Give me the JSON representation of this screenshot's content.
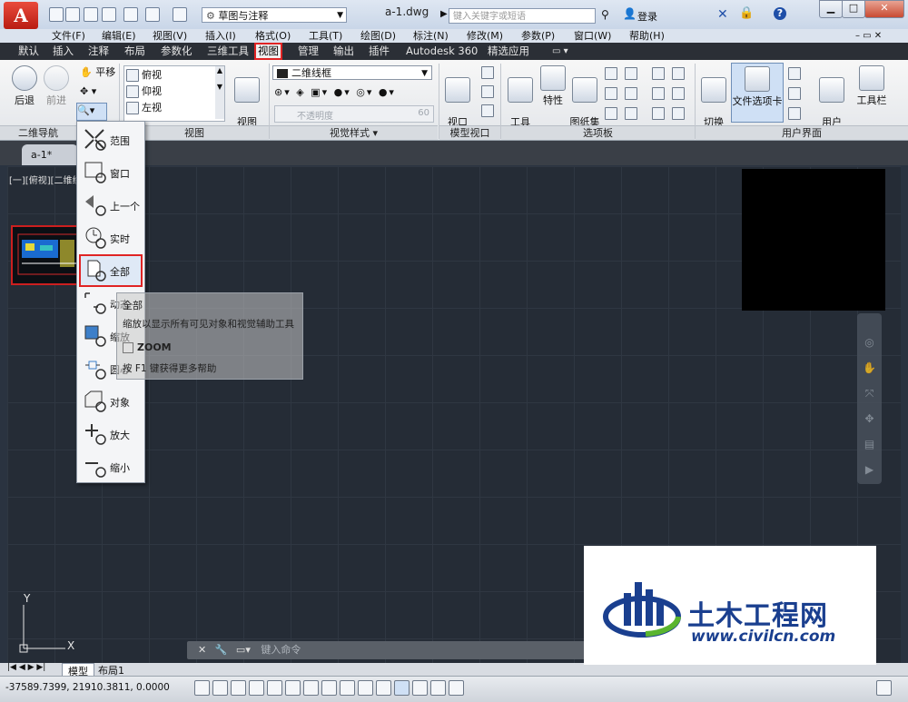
{
  "titlebar": {
    "app_letter": "A",
    "workspace": "草图与注释",
    "doc_title": "a-1.dwg",
    "search_placeholder": "键入关键字或短语",
    "login": "登录",
    "help": "?"
  },
  "menu": [
    "文件(F)",
    "编辑(E)",
    "视图(V)",
    "插入(I)",
    "格式(O)",
    "工具(T)",
    "绘图(D)",
    "标注(N)",
    "修改(M)",
    "参数(P)",
    "窗口(W)",
    "帮助(H)"
  ],
  "ribbon_tabs": [
    "默认",
    "插入",
    "注释",
    "布局",
    "参数化",
    "三维工具",
    "视图",
    "管理",
    "输出",
    "插件",
    "Autodesk 360",
    "精选应用"
  ],
  "active_tab": "视图",
  "ribbon": {
    "nav2d": {
      "back": "后退",
      "forward": "前进",
      "pan": "平移",
      "title": "二维导航"
    },
    "views": {
      "items": [
        "俯视",
        "仰视",
        "左视"
      ],
      "manager": "视图\n管理器",
      "title": "视图"
    },
    "visual": {
      "style": "二维线框",
      "opacity_label": "不透明度",
      "opacity_value": "60",
      "title": "视觉样式"
    },
    "model_viewports": {
      "config": "视口\n配置",
      "title": "模型视口"
    },
    "palettes": {
      "tool_palette": "工具\n选项板",
      "properties": "特性",
      "sheet_set": "图纸集\n管理器",
      "title": "选项板"
    },
    "ui": {
      "switch_window": "切换\n窗口",
      "file_tabs": "文件选项卡",
      "user_interface": "用户\n界面",
      "toolbars": "工具栏",
      "title": "用户界面"
    }
  },
  "doc_tab": "a-1*",
  "viewport_label": "[一][俯视][二维线",
  "zoom_menu": [
    "范围",
    "窗口",
    "上一个",
    "实时",
    "全部",
    "动态",
    "缩放",
    "圆心",
    "对象",
    "放大",
    "缩小"
  ],
  "zoom_selected": "全部",
  "tooltip": {
    "title": "全部",
    "desc": "缩放以显示所有可见对象和视觉辅助工具",
    "command": "ZOOM",
    "help": "按 F1 键获得更多帮助"
  },
  "command_placeholder": "键入命令",
  "layout_tabs": [
    "模型",
    "布局1"
  ],
  "coordinates": "-37589.7399, 21910.3811, 0.0000",
  "axis": {
    "y": "Y",
    "x": "X"
  },
  "watermark": {
    "brand": "土木工程网",
    "url": "www.civilcn.com"
  },
  "colors": {
    "accent_red": "#e02424",
    "canvas": "#252c36",
    "brand_blue": "#1a3f8f",
    "brand_green": "#5ab52f"
  }
}
